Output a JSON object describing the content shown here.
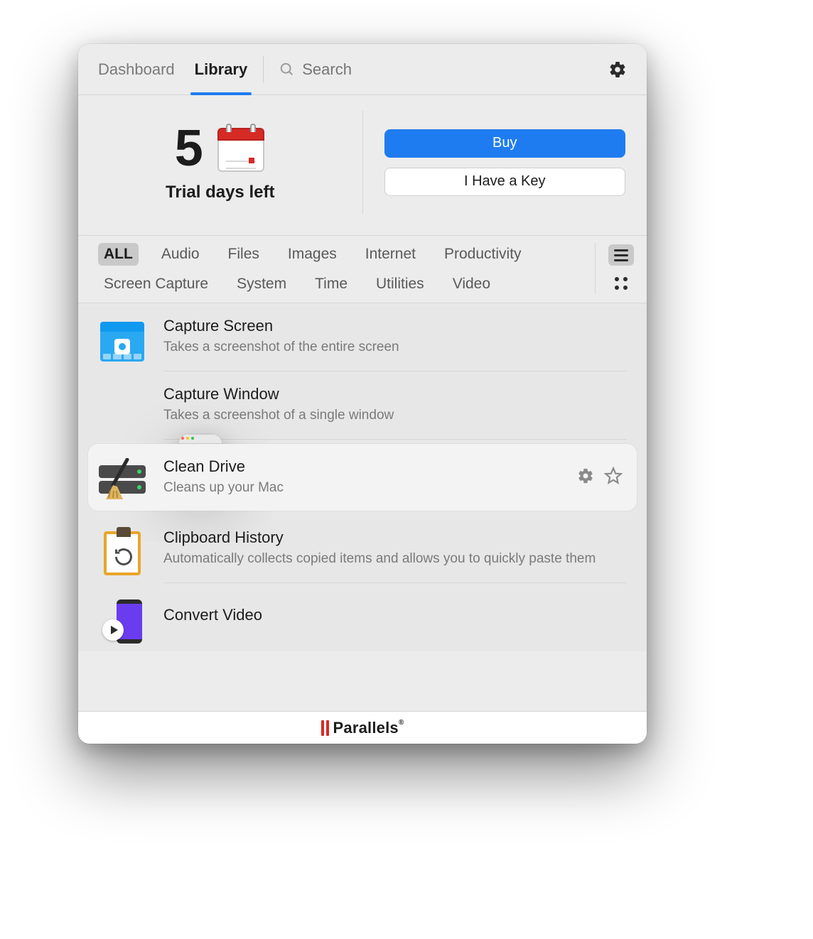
{
  "tabs": {
    "dashboard": "Dashboard",
    "library": "Library",
    "active": "library"
  },
  "search": {
    "placeholder": "Search"
  },
  "trial": {
    "days": "5",
    "label": "Trial days left",
    "buy": "Buy",
    "have_key": "I Have a Key"
  },
  "filters": {
    "items": [
      "ALL",
      "Audio",
      "Files",
      "Images",
      "Internet",
      "Productivity",
      "Screen Capture",
      "System",
      "Time",
      "Utilities",
      "Video"
    ],
    "active": "ALL",
    "view": "list"
  },
  "items": [
    {
      "icon": "capture-screen",
      "title": "Capture Screen",
      "desc": "Takes a screenshot of the entire screen",
      "hovered": false
    },
    {
      "icon": "capture-window",
      "title": "Capture Window",
      "desc": "Takes a screenshot of a single window",
      "hovered": false
    },
    {
      "icon": "clean-drive",
      "title": "Clean Drive",
      "desc": "Cleans up your Mac",
      "hovered": true
    },
    {
      "icon": "clipboard-history",
      "title": "Clipboard History",
      "desc": "Automatically collects copied items and allows you to quickly paste them",
      "hovered": false
    },
    {
      "icon": "convert-video",
      "title": "Convert Video",
      "desc": "",
      "hovered": false
    }
  ],
  "footer": {
    "brand": "Parallels"
  }
}
